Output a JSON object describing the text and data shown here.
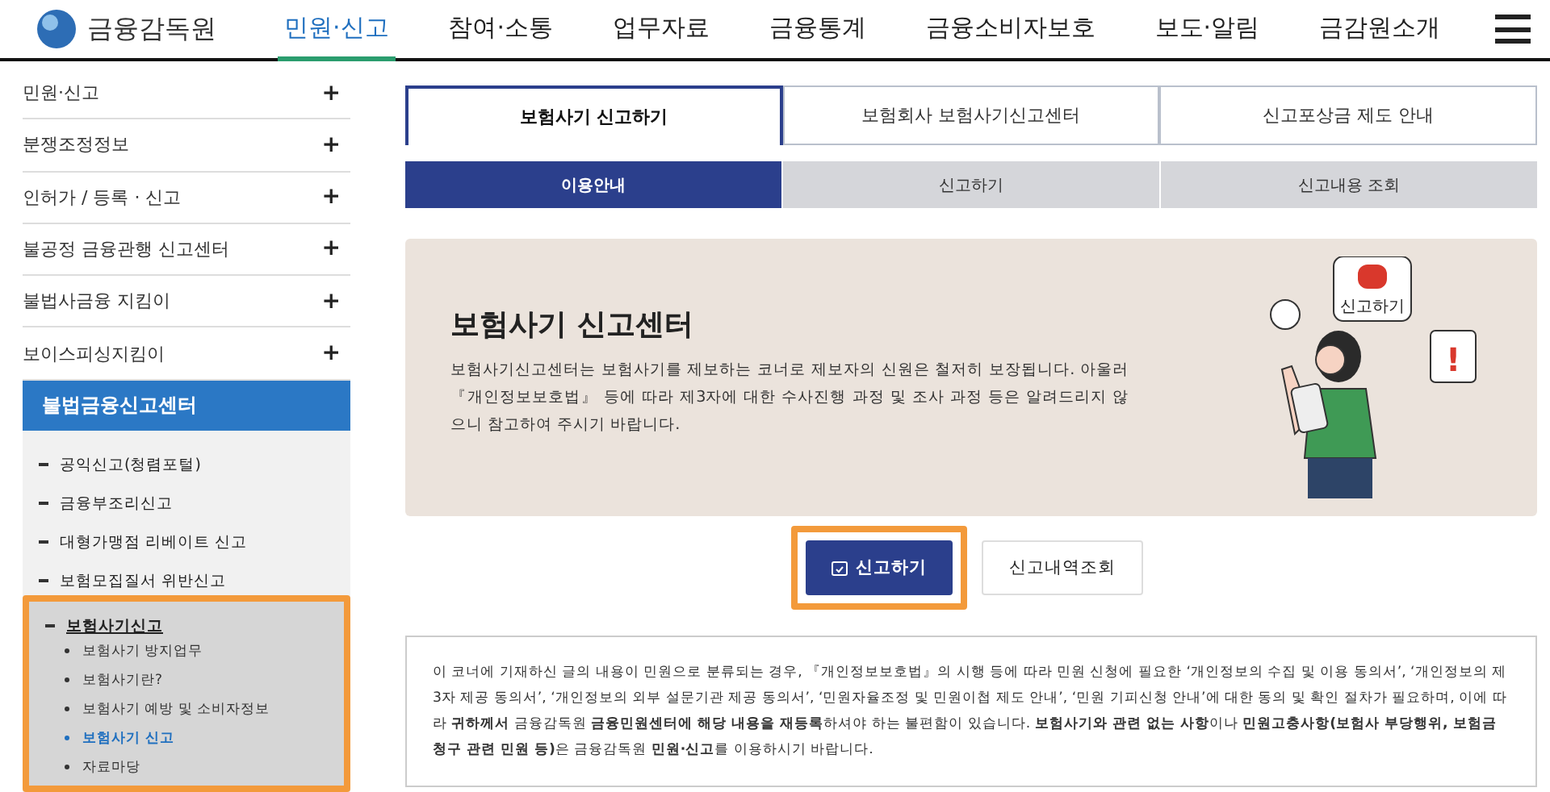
{
  "header": {
    "logo_text": "금융감독원",
    "nav": [
      {
        "label": "민원·신고",
        "selected": true
      },
      {
        "label": "참여·소통",
        "selected": false
      },
      {
        "label": "업무자료",
        "selected": false
      },
      {
        "label": "금융통계",
        "selected": false
      },
      {
        "label": "금융소비자보호",
        "selected": false
      },
      {
        "label": "보도·알림",
        "selected": false
      },
      {
        "label": "금감원소개",
        "selected": false
      }
    ]
  },
  "sidebar": {
    "items": [
      {
        "label": "민원·신고",
        "expanded": false,
        "toggle": "+"
      },
      {
        "label": "분쟁조정정보",
        "expanded": false,
        "toggle": "+"
      },
      {
        "label": "인허가 / 등록 · 신고",
        "expanded": false,
        "toggle": "+"
      },
      {
        "label": "불공정 금융관행 신고센터",
        "expanded": false,
        "toggle": "+"
      },
      {
        "label": "불법사금융 지킴이",
        "expanded": false,
        "toggle": "+"
      },
      {
        "label": "보이스피싱지킴이",
        "expanded": false,
        "toggle": "+"
      }
    ],
    "section": {
      "title": "불법금융신고센터",
      "children": [
        {
          "label": "공익신고(청렴포털)",
          "selected": false,
          "highlighted": false
        },
        {
          "label": "금융부조리신고",
          "selected": false,
          "highlighted": false
        },
        {
          "label": "대형가맹점 리베이트 신고",
          "selected": false,
          "highlighted": false
        },
        {
          "label": "보험모집질서 위반신고",
          "selected": false,
          "highlighted": false
        },
        {
          "label": "보험사기신고",
          "selected": true,
          "highlighted": true,
          "children": [
            {
              "label": "보험사기 방지업무",
              "selected": false
            },
            {
              "label": "보험사기란?",
              "selected": false
            },
            {
              "label": "보험사기 예방 및 소비자정보",
              "selected": false
            },
            {
              "label": "보험사기 신고",
              "selected": true
            },
            {
              "label": "자료마당",
              "selected": false
            }
          ]
        }
      ]
    }
  },
  "tabs": [
    {
      "label": "보험사기 신고하기",
      "selected": true
    },
    {
      "label": "보험회사 보험사기신고센터",
      "selected": false
    },
    {
      "label": "신고포상금 제도 안내",
      "selected": false
    }
  ],
  "subtabs": [
    {
      "label": "이용안내",
      "selected": true
    },
    {
      "label": "신고하기",
      "selected": false
    },
    {
      "label": "신고내용 조회",
      "selected": false
    }
  ],
  "banner": {
    "title": "보험사기 신고센터",
    "text": "보험사기신고센터는 보험사기를 제보하는 코너로 제보자의 신원은 철저히 보장됩니다. 아울러 『개인정보보호법』 등에 따라 제3자에 대한 수사진행 과정 및 조사 과정 등은 알려드리지 않으니 참고하여 주시기 바랍니다.",
    "siren_label": "신고하기",
    "alert_mark": "!"
  },
  "actions": [
    {
      "label": "신고하기",
      "kind": "primary",
      "highlighted": true
    },
    {
      "label": "신고내역조회",
      "kind": "secondary",
      "highlighted": false
    }
  ],
  "notice": "이 코너에 기재하신 글의 내용이 민원으로 분류되는 경우, 『개인정보보호법』의 시행 등에 따라 민원 신청에 필요한 ‘개인정보의 수집 및 이용 동의서’, ‘개인정보의 제3자 제공 동의서’, ‘개인정보의 외부 설문기관 제공 동의서’, ‘민원자율조정 및 민원이첩 제도 안내’, ‘민원 기피신청 안내’에 대한 동의 및 확인 절차가 필요하며, 이에 따라 **귀하께서** 금융감독원 **금융민원센터에 해당 내용을 재등록**하셔야 하는 불편함이 있습니다. **보험사기와 관련 없는 사항**이나 **민원고충사항(보험사 부당행위, 보험금 청구 관련 민원 등)**은 금융감독원 **민원·신고**를 이용하시기 바랍니다."
}
